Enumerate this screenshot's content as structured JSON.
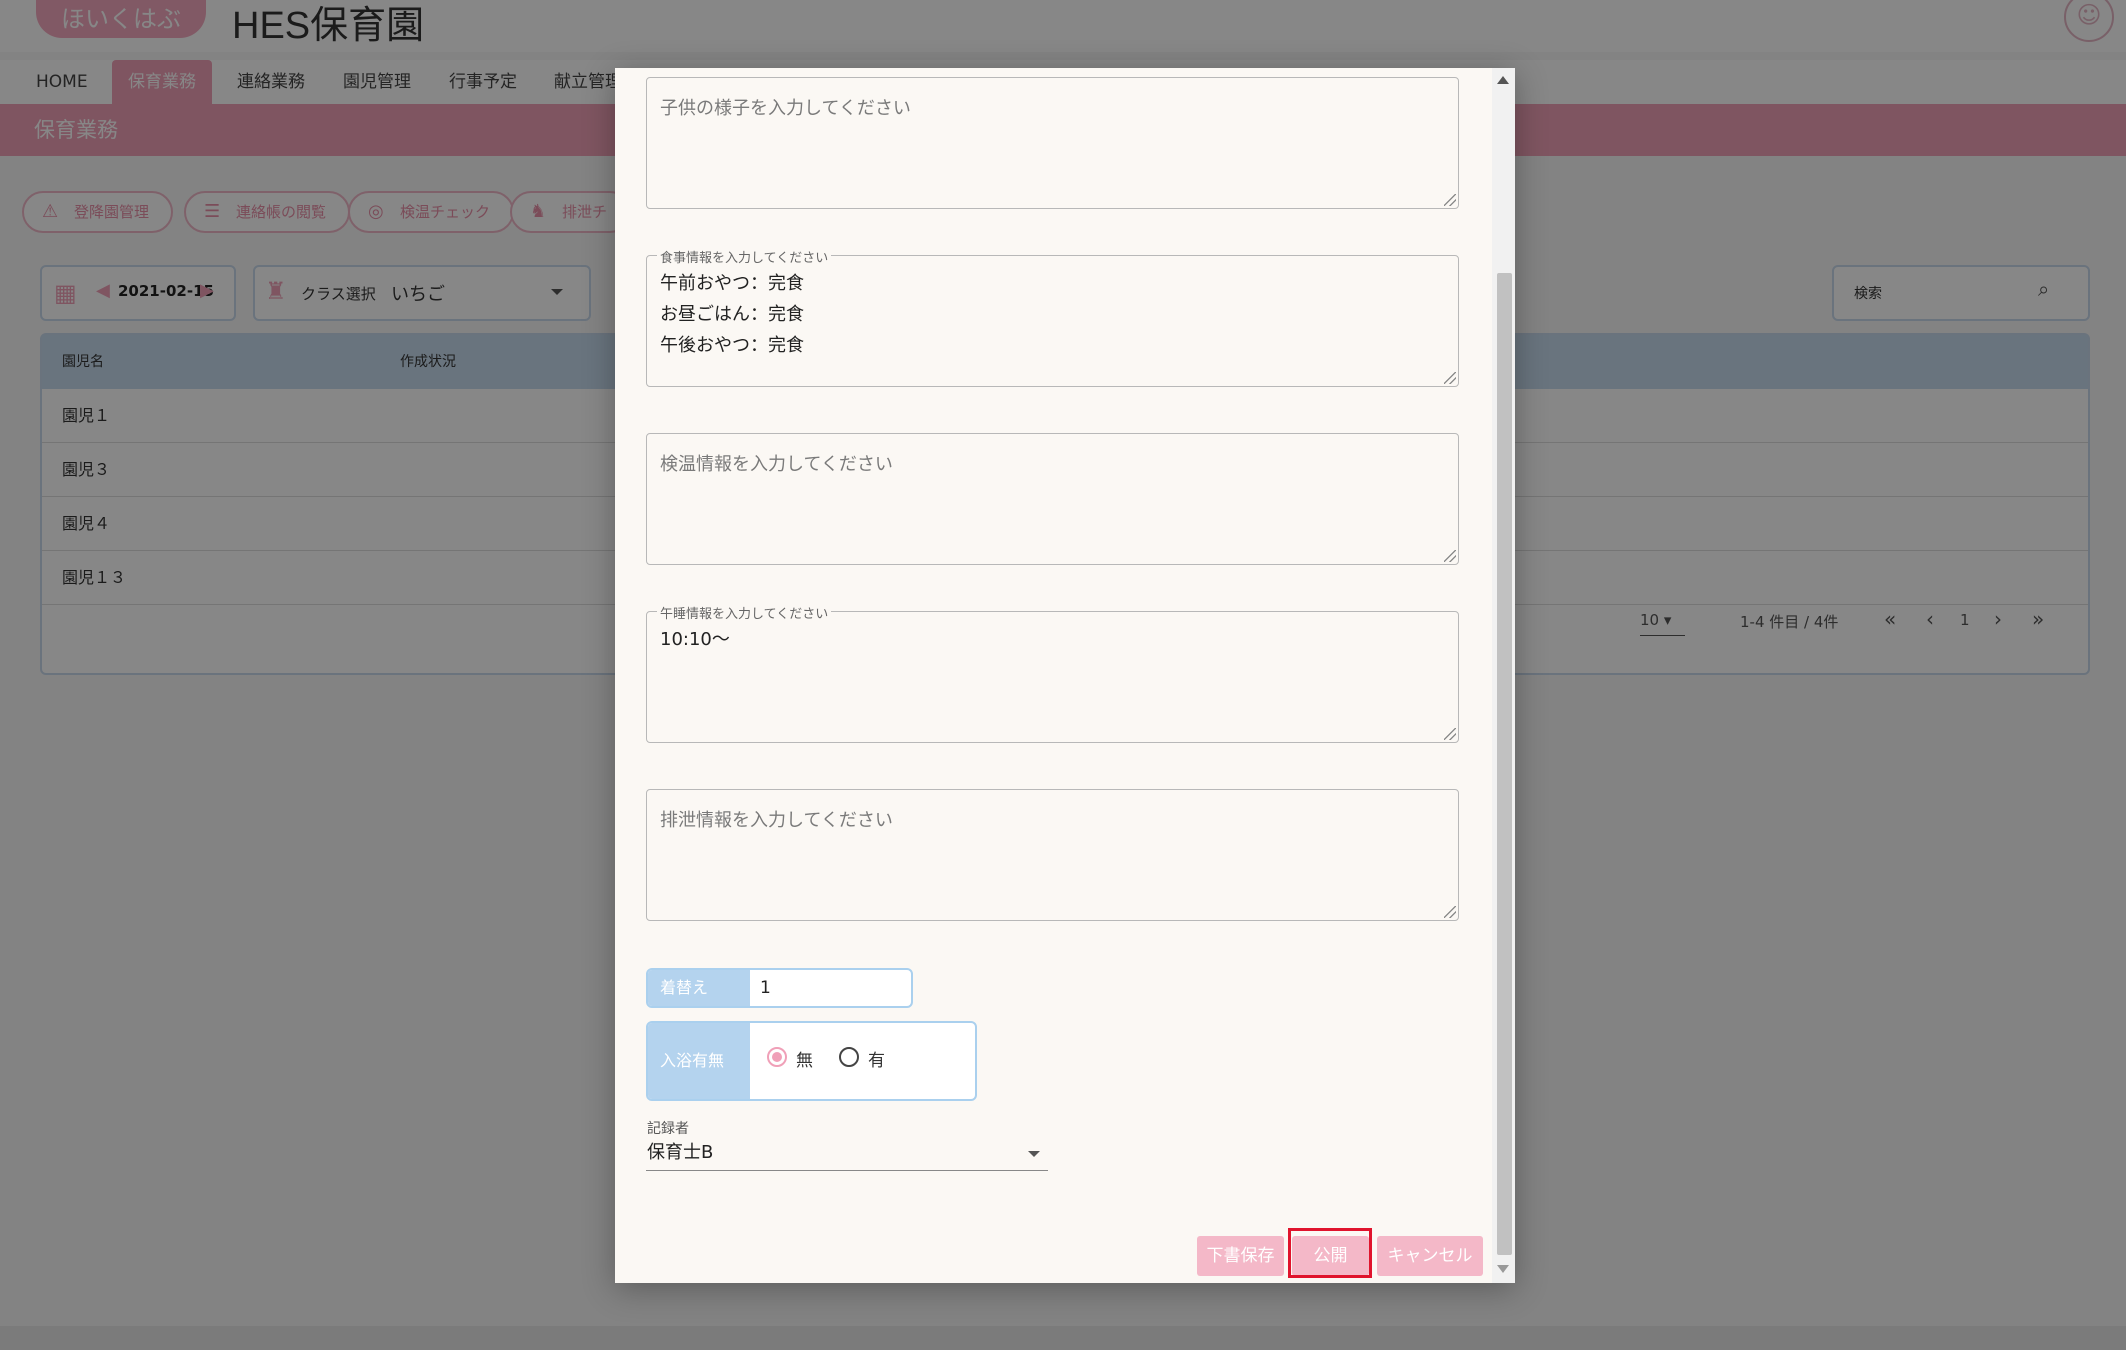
{
  "app": {
    "logo_text": "ほいくはぶ",
    "title": "HES保育園"
  },
  "nav": {
    "items": [
      "HOME",
      "保育業務",
      "連絡業務",
      "園児管理",
      "行事予定",
      "献立管理"
    ]
  },
  "section": {
    "title": "保育業務"
  },
  "action_pills": {
    "items": [
      "登降園管理",
      "連絡帳の閲覧",
      "検温チェック",
      "排泄チ"
    ]
  },
  "filters": {
    "date": "2021-02-15",
    "class_label": "クラス選択",
    "class_value": "いちご",
    "search_placeholder": "検索"
  },
  "table": {
    "headers": [
      "園児名",
      "作成状況"
    ],
    "rows": [
      "園児１",
      "園児３",
      "園児４",
      "園児１３"
    ],
    "per_page": "10",
    "range": "1-4 件目 / 4件",
    "page": "1"
  },
  "dialog": {
    "child_state_placeholder": "子供の様子を入力してください",
    "meal": {
      "legend": "食事情報を入力してください",
      "lines": [
        "午前おやつ：完食",
        "お昼ごはん：完食",
        "午後おやつ：完食"
      ]
    },
    "temperature_placeholder": "検温情報を入力してください",
    "nap": {
      "legend": "午睡情報を入力してください",
      "value": "10:10～"
    },
    "excretion_placeholder": "排泄情報を入力してください",
    "clothes": {
      "label": "着替え",
      "value": "1"
    },
    "bath": {
      "label": "入浴有無",
      "options": [
        "無",
        "有"
      ],
      "selected": "無"
    },
    "recorder": {
      "label": "記録者",
      "value": "保育士B"
    },
    "buttons": {
      "draft": "下書保存",
      "publish": "公開",
      "cancel": "キャンセル"
    }
  },
  "colors": {
    "accent_pink": "#f0a0b8",
    "table_header": "#c7dbef",
    "highlight_red": "#e0142d"
  }
}
